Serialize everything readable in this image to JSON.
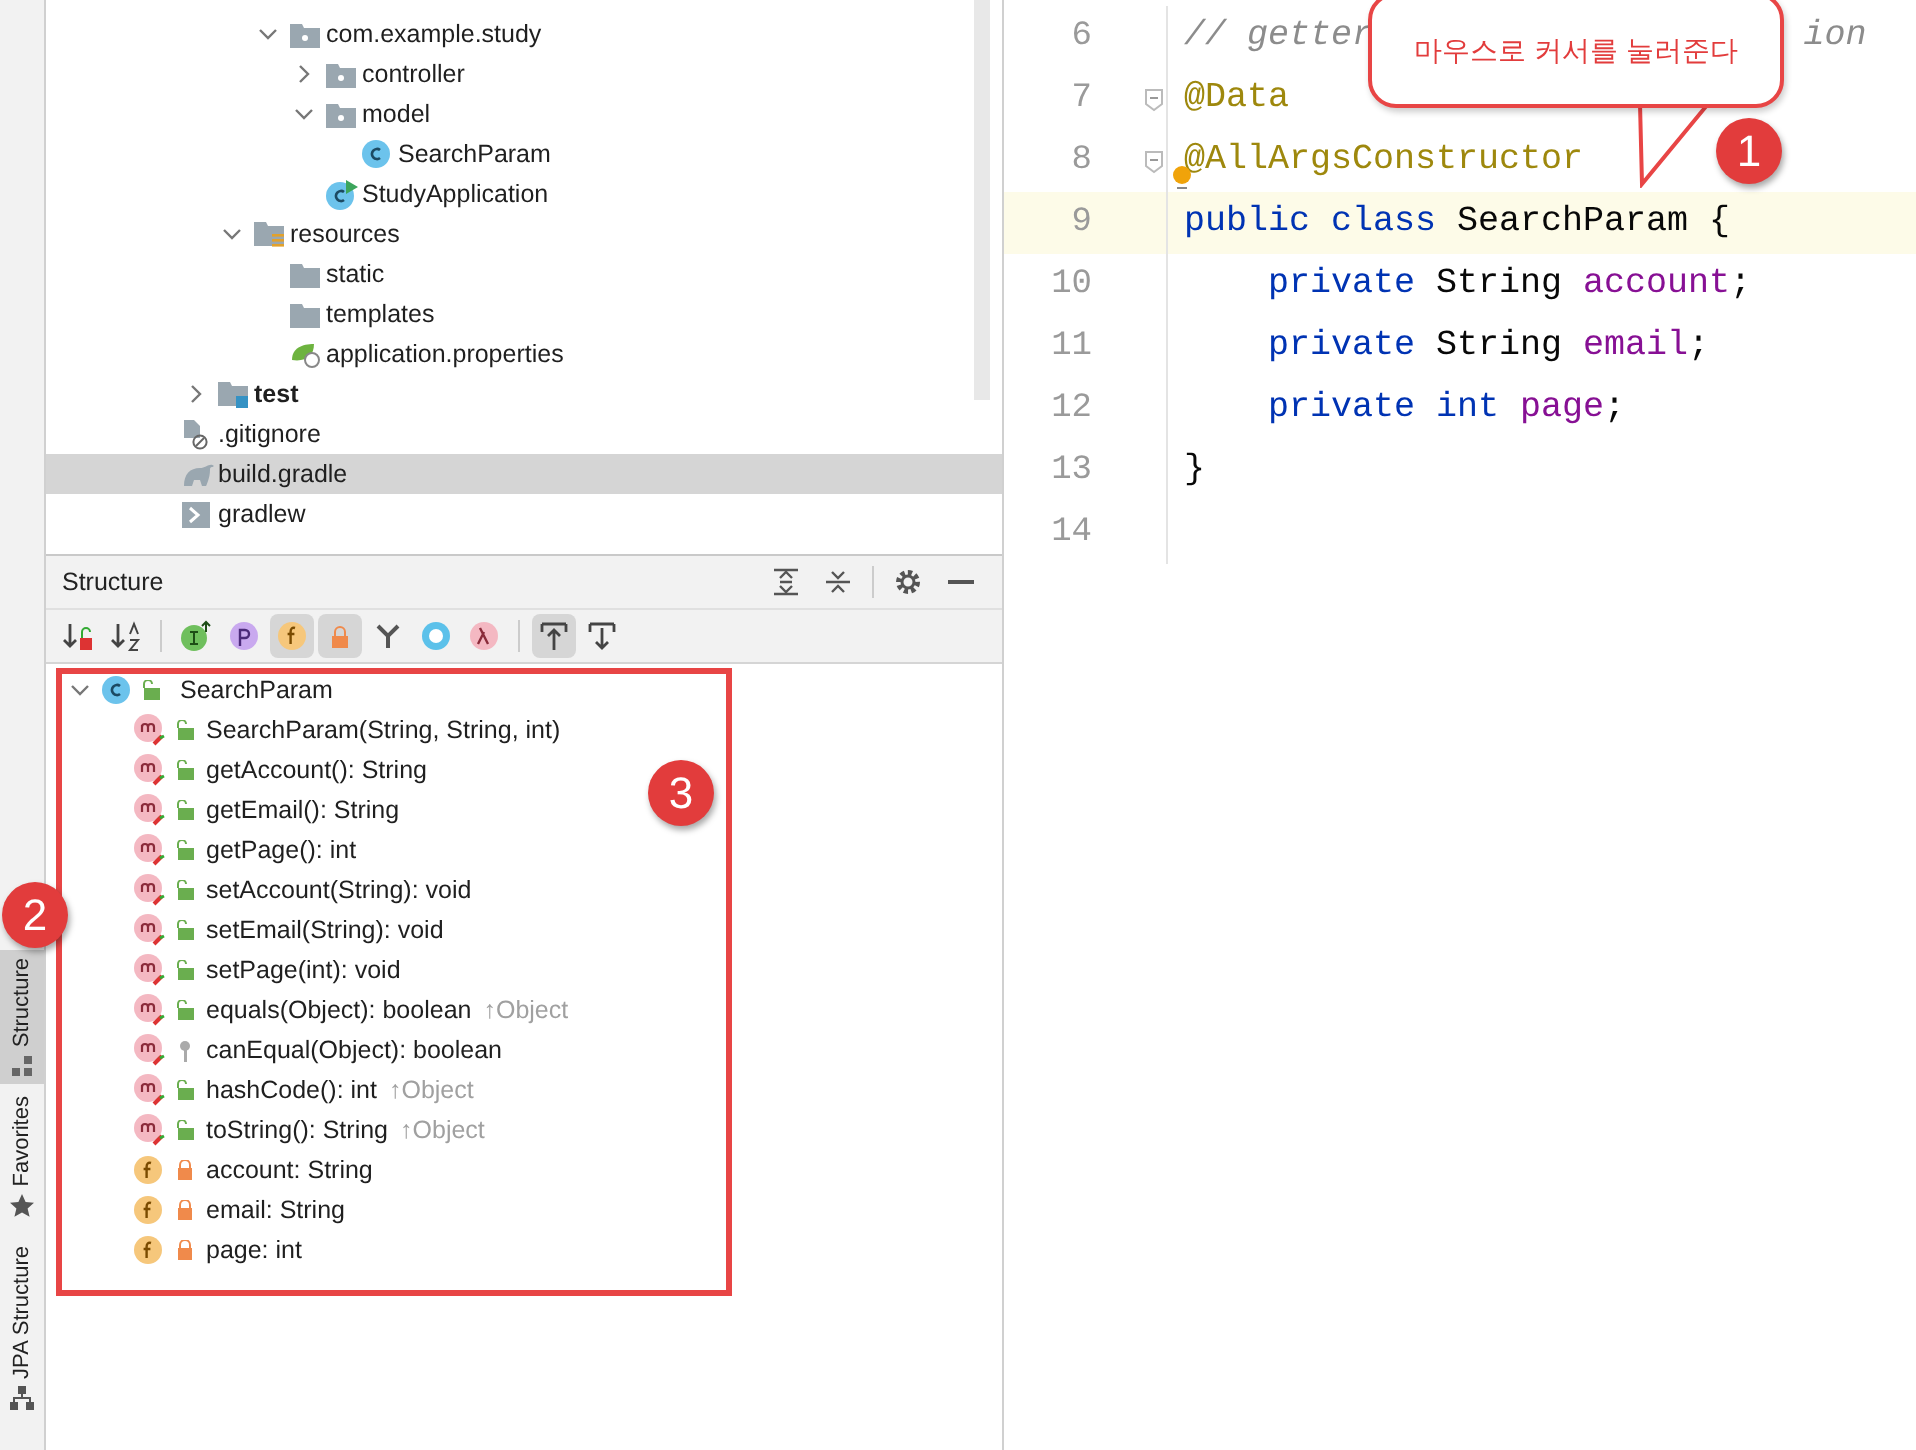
{
  "side_tabs": [
    {
      "label": "Structure",
      "selected": true
    },
    {
      "label": "Favorites",
      "selected": false
    },
    {
      "label": "JPA Structure",
      "selected": false
    }
  ],
  "project_tree": [
    {
      "children": [
        {
          "children": [
            {
              "children": [
                {
                  "label": "com.example.study",
                  "kind": "package",
                  "expanded": true,
                  "children": [
                    {
                      "label": "controller",
                      "kind": "package",
                      "expanded": false
                    },
                    {
                      "label": "model",
                      "kind": "package",
                      "expanded": true,
                      "children": [
                        {
                          "label": "SearchParam",
                          "kind": "class"
                        }
                      ]
                    },
                    {
                      "label": "StudyApplication",
                      "kind": "app-class"
                    }
                  ]
                }
              ]
            },
            {
              "label": "resources",
              "kind": "resources",
              "expanded": true,
              "children": [
                {
                  "label": "static",
                  "kind": "folder"
                },
                {
                  "label": "templates",
                  "kind": "folder"
                },
                {
                  "label": "application.properties",
                  "kind": "properties"
                }
              ]
            }
          ]
        },
        {
          "label": "test",
          "kind": "test-folder",
          "expanded": false,
          "bold": true
        }
      ]
    },
    {
      "label": ".gitignore",
      "kind": "ignore-file",
      "selected": false
    },
    {
      "label": "build.gradle",
      "kind": "gradle",
      "selected": true
    },
    {
      "label": "gradlew",
      "kind": "script",
      "selected": false
    }
  ],
  "structure": {
    "title": "Structure",
    "header_buttons": [
      {
        "kind": "expand"
      },
      {
        "kind": "collapse"
      },
      {
        "kind": "settings"
      },
      {
        "kind": "minimize"
      }
    ],
    "toolbar": [
      {
        "kind": "sort-visibility",
        "selected": false
      },
      {
        "kind": "sort-alpha",
        "selected": false
      },
      {
        "kind": "inherited",
        "selected": false
      },
      {
        "kind": "properties",
        "selected": false
      },
      {
        "kind": "fields",
        "selected": true
      },
      {
        "kind": "non-public",
        "selected": true
      },
      {
        "kind": "branch",
        "selected": false
      },
      {
        "kind": "anonymous",
        "selected": false
      },
      {
        "kind": "lambda",
        "selected": false
      },
      {
        "kind": "autoscroll-to",
        "selected": true
      },
      {
        "kind": "autoscroll-from",
        "selected": false
      }
    ],
    "root": {
      "label": "SearchParam",
      "kind": "public-class",
      "expanded": true
    },
    "members": [
      {
        "label": "SearchParam(String, String, int)",
        "kind": "public-method"
      },
      {
        "label": "getAccount(): String",
        "kind": "public-method"
      },
      {
        "label": "getEmail(): String",
        "kind": "public-method"
      },
      {
        "label": "getPage(): int",
        "kind": "public-method"
      },
      {
        "label": "setAccount(String): void",
        "kind": "public-method"
      },
      {
        "label": "setEmail(String): void",
        "kind": "public-method"
      },
      {
        "label": "setPage(int): void",
        "kind": "public-method"
      },
      {
        "label": "equals(Object): boolean",
        "kind": "public-method",
        "inherited": "↑Object"
      },
      {
        "label": "canEqual(Object): boolean",
        "kind": "package-method"
      },
      {
        "label": "hashCode(): int",
        "kind": "public-method",
        "inherited": "↑Object"
      },
      {
        "label": "toString(): String",
        "kind": "public-method",
        "inherited": "↑Object"
      },
      {
        "label": "account: String",
        "kind": "private-field"
      },
      {
        "label": "email: String",
        "kind": "private-field"
      },
      {
        "label": "page: int",
        "kind": "private-field"
      }
    ]
  },
  "editor": {
    "lines": [
      {
        "number": "6",
        "current": false,
        "tokens": [
          {
            "kind": "comment",
            "text": "// getter"
          },
          {
            "kind": "comment-after-gap",
            "text": "ion"
          }
        ]
      },
      {
        "number": "7",
        "current": false,
        "fold": true,
        "tokens": [
          {
            "kind": "annotation",
            "text": "@Data"
          }
        ]
      },
      {
        "number": "8",
        "current": false,
        "fold": true,
        "bulb": true,
        "tokens": [
          {
            "kind": "annotation",
            "text": "@AllArgsConstructor"
          }
        ]
      },
      {
        "number": "9",
        "current": true,
        "tokens": [
          {
            "kind": "keyword",
            "text": "public class "
          },
          {
            "kind": "plain",
            "text": "SearchParam {"
          }
        ]
      },
      {
        "number": "10",
        "current": false,
        "indented": true,
        "tokens": [
          {
            "kind": "keyword",
            "text": "private "
          },
          {
            "kind": "plain",
            "text": "String "
          },
          {
            "kind": "field",
            "text": "account"
          },
          {
            "kind": "plain",
            "text": ";"
          }
        ]
      },
      {
        "number": "11",
        "current": false,
        "indented": true,
        "tokens": [
          {
            "kind": "keyword",
            "text": "private "
          },
          {
            "kind": "plain",
            "text": "String "
          },
          {
            "kind": "field",
            "text": "email"
          },
          {
            "kind": "plain",
            "text": ";"
          }
        ]
      },
      {
        "number": "12",
        "current": false,
        "indented": true,
        "tokens": [
          {
            "kind": "keyword",
            "text": "private int "
          },
          {
            "kind": "field",
            "text": "page"
          },
          {
            "kind": "plain",
            "text": ";"
          }
        ]
      },
      {
        "number": "13",
        "current": false,
        "tokens": [
          {
            "kind": "plain",
            "text": "}"
          }
        ]
      },
      {
        "number": "14",
        "current": false
      }
    ]
  },
  "annotations": {
    "callout": "마우스로 커서를 눌러준다",
    "badges": [
      "1",
      "2",
      "3"
    ]
  }
}
